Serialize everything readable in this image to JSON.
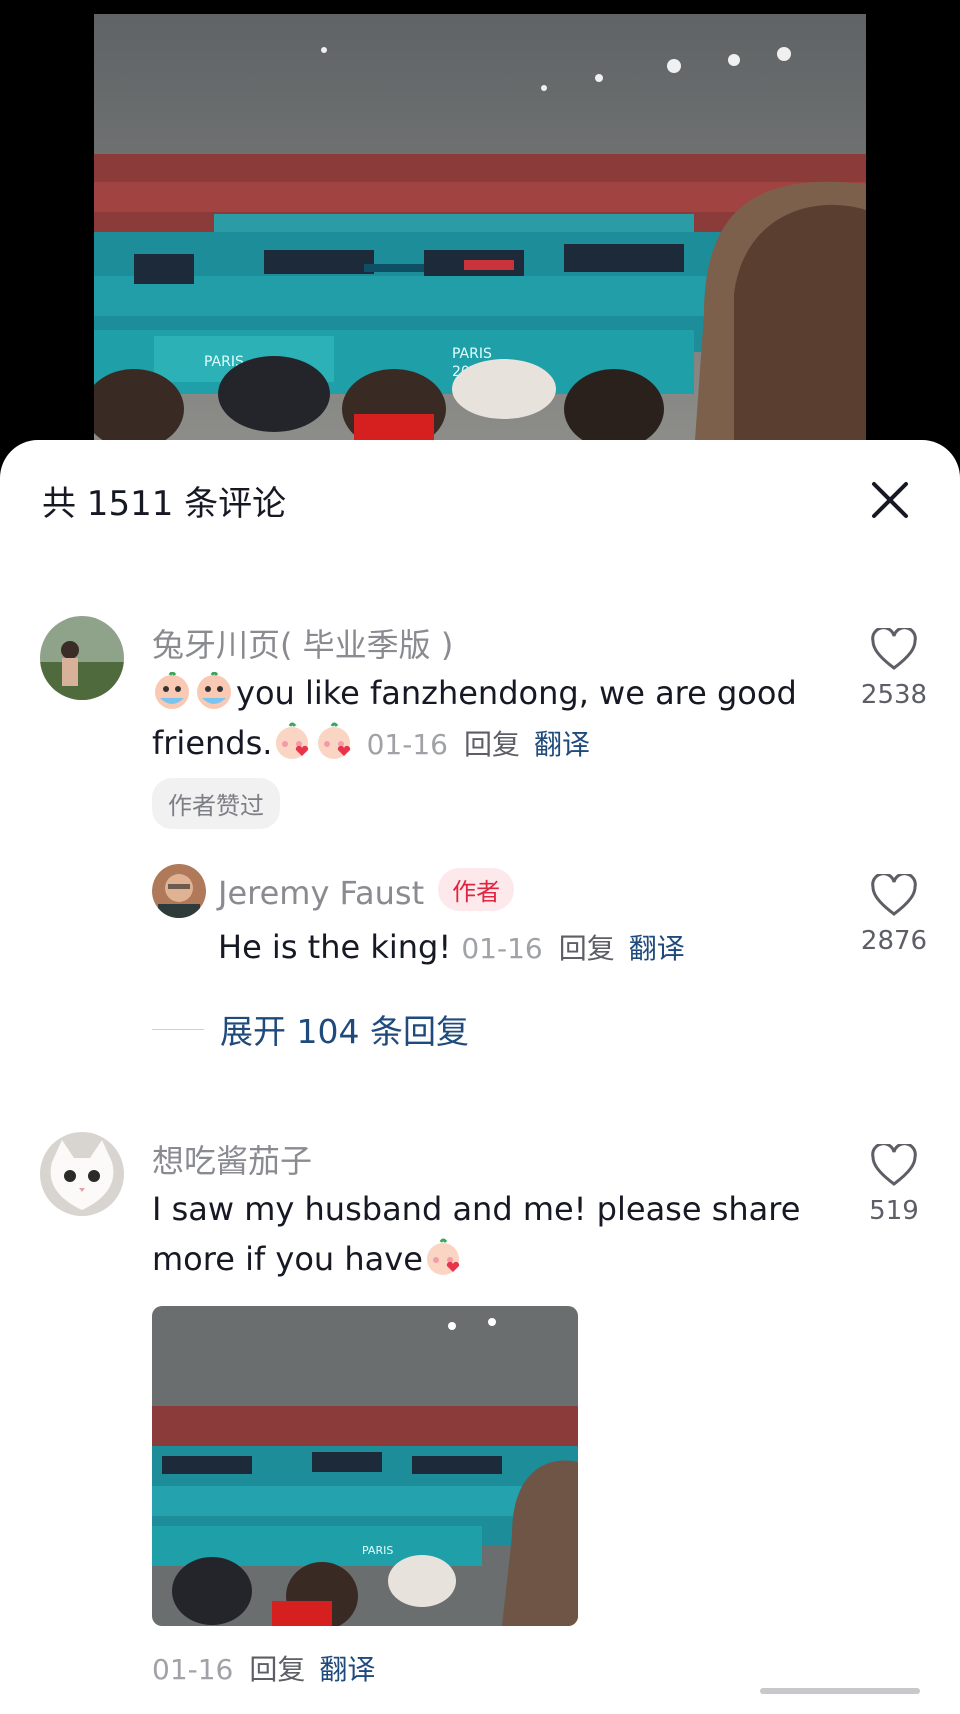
{
  "header": {
    "title": "共 1511 条评论"
  },
  "comments": [
    {
      "user": "兔牙川页( 毕业季版 )",
      "text": "you like fanzhendong, we are good friends.",
      "date": "01-16",
      "reply_label": "回复",
      "translate_label": "翻译",
      "likes": "2538",
      "author_liked": "作者赞过"
    },
    {
      "user": "想吃酱茄子",
      "text_line1": "I saw my husband and me! please share",
      "text_line2": "more if you have",
      "date": "01-16",
      "reply_label": "回复",
      "translate_label": "翻译",
      "likes": "519"
    }
  ],
  "reply": {
    "user": "Jeremy Faust",
    "author_tag": "作者",
    "text": "He is the king!",
    "date": "01-16",
    "reply_label": "回复",
    "translate_label": "翻译",
    "likes": "2876"
  },
  "expand": {
    "label": "展开 104 条回复"
  },
  "icons": {
    "close": "close-icon",
    "like": "heart-outline-icon",
    "emoji_crying": "crying-emoji-icon",
    "emoji_kiss": "kiss-emoji-icon"
  },
  "colors": {
    "link_blue": "#1f4a7c",
    "author_tag_red": "#e0263f",
    "author_tag_bg": "#fde8ec"
  }
}
